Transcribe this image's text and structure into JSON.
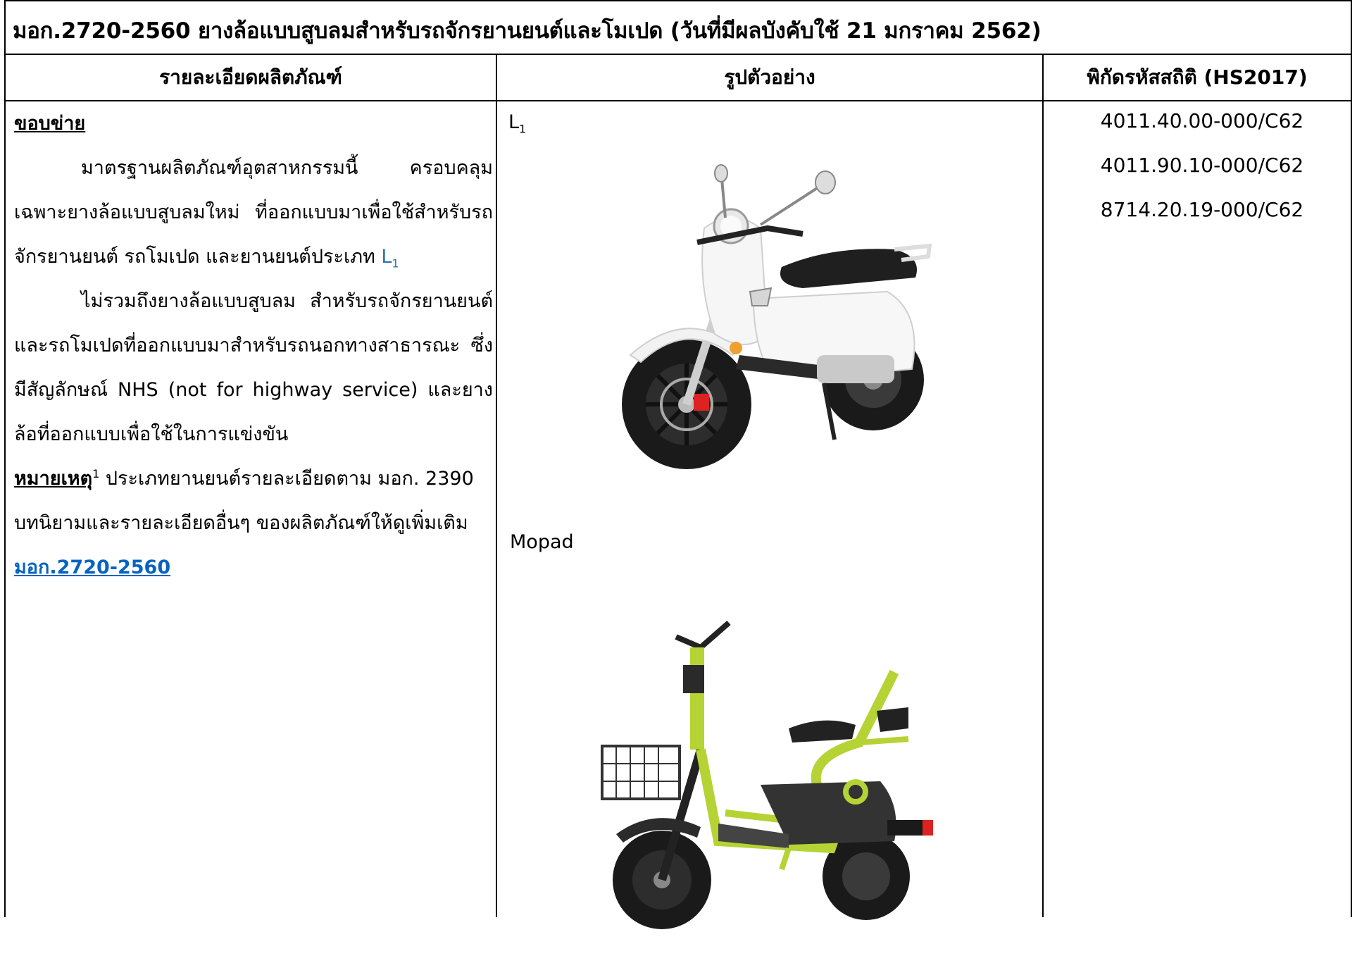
{
  "title": "มอก.2720-2560 ยางล้อแบบสูบลมสำหรับรถจักรยานยนต์และโมเปด (วันที่มีผลบังคับใช้ 21 มกราคม 2562)",
  "headers": {
    "details": "รายละเอียดผลิตภัณฑ์",
    "example": "รูปตัวอย่าง",
    "hs": "พิกัดรหัสสถิติ (HS2017)"
  },
  "details": {
    "scope_heading": "ขอบข่าย",
    "para1": "มาตรฐานผลิตภัณฑ์อุตสาหกรรมนี้ ครอบคลุมเฉพาะยางล้อแบบสูบลมใหม่ ที่ออกแบบมาเพื่อใช้สำหรับรถจักรยานยนต์ รถโมเปด และยานยนต์ประเภท",
    "para1_ref_letter": "L",
    "para1_ref_sub": "1",
    "para2": "ไม่รวมถึงยางล้อแบบสูบลม สำหรับรถจักรยานยนต์และรถโมเปดที่ออกแบบมาสำหรับรถนอกทางสาธารณะ ซึ่งมีสัญลักษณ์ NHS (not for highway service) และยางล้อที่ออกแบบเพื่อใช้ในการแข่งขัน",
    "note_heading": "หมายเหตุ",
    "note_sup": "1",
    "note_text": " ประเภทยานยนต์รายละเอียดตาม มอก. 2390",
    "more_text": "บทนิยามและรายละเอียดอื่นๆ ของผลิตภัณฑ์ให้ดูเพิ่มเติม ",
    "more_link": "มอก.2720-2560"
  },
  "examples": {
    "label1_letter": "L",
    "label1_sub": "1",
    "label2": "Mopad"
  },
  "hs_codes": [
    "4011.40.00-000/C62",
    "4011.90.10-000/C62",
    "8714.20.19-000/C62"
  ],
  "colors": {
    "ref_blue": "#2e74b5",
    "link_blue": "#0563c1",
    "ebike_green": "#b5d334"
  },
  "icons": [
    "white-scooter-image",
    "green-ebike-image"
  ]
}
